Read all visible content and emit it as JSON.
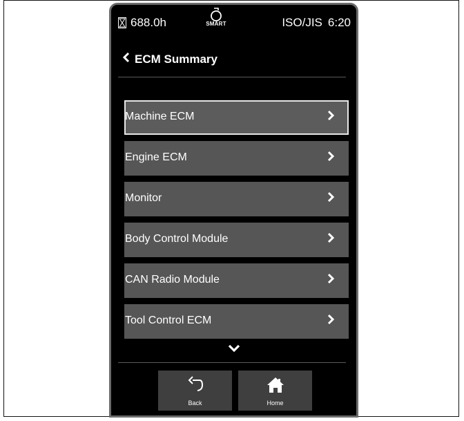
{
  "status_bar": {
    "hours": "688.0h",
    "smart_label": "SMART",
    "units": "ISO/JIS",
    "time": "6:20"
  },
  "header": {
    "title": "ECM Summary"
  },
  "list": {
    "items": [
      {
        "label": "Machine ECM"
      },
      {
        "label": "Engine ECM"
      },
      {
        "label": "Monitor"
      },
      {
        "label": "Body Control Module"
      },
      {
        "label": "CAN Radio Module"
      },
      {
        "label": "Tool Control ECM"
      }
    ],
    "selected_index": 0
  },
  "footer": {
    "back_label": "Back",
    "home_label": "Home"
  },
  "icons": {
    "hourglass": "hourglass-icon",
    "smart": "smart-engine-icon",
    "back_chevron": "chevron-left-icon",
    "item_chevron": "chevron-right-icon",
    "more": "chevron-down-icon",
    "back": "undo-arrow-icon",
    "home": "house-icon"
  },
  "colors": {
    "screen_bg": "#000000",
    "item_bg": "#565656",
    "footer_btn_bg": "#3f3f3f",
    "text": "#ffffff"
  }
}
